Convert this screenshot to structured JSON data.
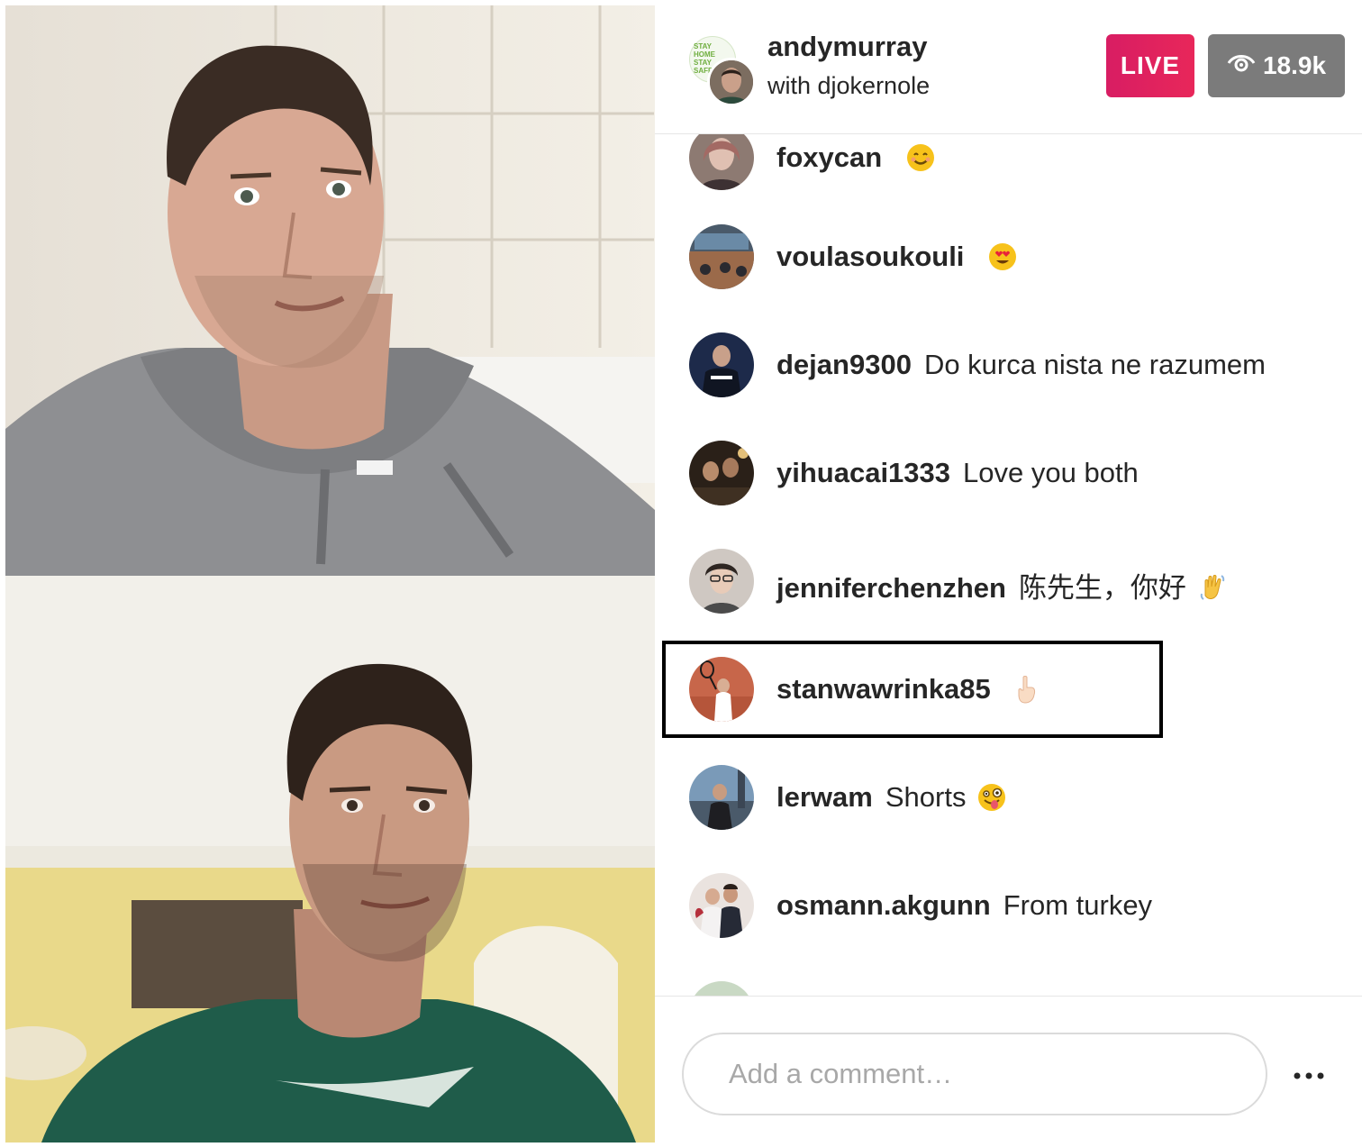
{
  "header": {
    "host_username": "andymurray",
    "guest_line": "with djokernole",
    "host_avatar_text": "STAY HOME STAY SAFE",
    "live_label": "LIVE",
    "viewer_count": "18.9k",
    "viewer_icon": "eye-icon"
  },
  "comments": [
    {
      "username": "foxycan",
      "message": "",
      "emoji": "smiling-face"
    },
    {
      "username": "voulasoukouli",
      "message": "",
      "emoji": "heart-eyes-face"
    },
    {
      "username": "dejan9300",
      "message": "Do kurca nista ne razumem",
      "emoji": ""
    },
    {
      "username": "yihuacai1333",
      "message": "Love you both",
      "emoji": ""
    },
    {
      "username": "jenniferchenzhen",
      "message": "陈先生，你好",
      "emoji": "waving-hand"
    },
    {
      "username": "stanwawrinka85",
      "message": "",
      "emoji": "pointing-up-hand",
      "highlighted": true
    },
    {
      "username": "lerwam",
      "message": "Shorts",
      "emoji": "zany-face"
    },
    {
      "username": "osmann.akgunn",
      "message": "From turkey",
      "emoji": ""
    }
  ],
  "footer": {
    "comment_placeholder": "Add a comment…",
    "more_icon": "more-options-icon"
  },
  "colors": {
    "live_badge": "#e0245e",
    "viewer_badge": "#7b7b7b",
    "text": "#262626",
    "placeholder": "#a8a8a8",
    "highlight_border": "#000000"
  }
}
